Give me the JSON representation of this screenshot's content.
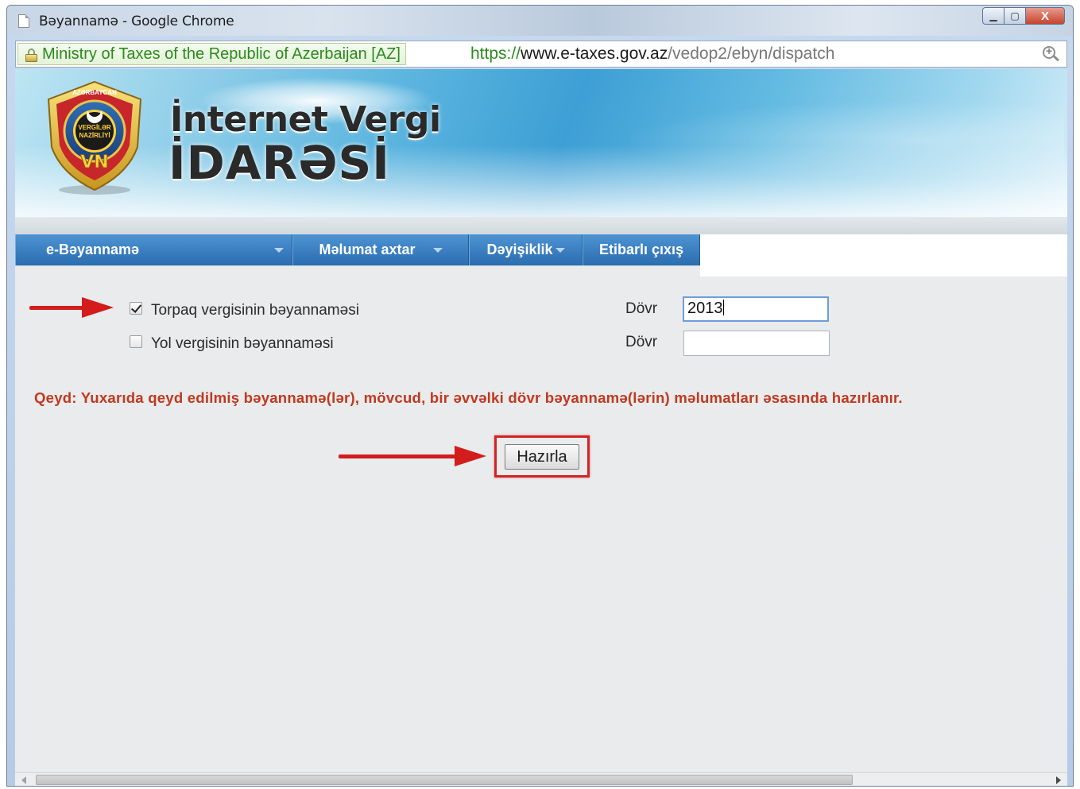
{
  "window": {
    "title": "Bəyannamə - Google Chrome",
    "minimize_symbol": "▁",
    "maximize_symbol": "▢",
    "close_symbol": "X"
  },
  "address_bar": {
    "ev_label": "Ministry of Taxes of the Republic of Azerbaijan [AZ]",
    "url_scheme": "https://",
    "url_host": "www.e-taxes.gov.az",
    "url_path": "/vedop2/ebyn/dispatch"
  },
  "banner": {
    "line1": "İnternet Vergi",
    "line2": "İDARƏSİ",
    "emblem_top_text": "AZƏRBAYCAN",
    "emblem_center_text_1": "VERGİLƏR",
    "emblem_center_text_2": "NAZİRLİYİ",
    "emblem_monogram": "VN"
  },
  "nav": {
    "items": [
      {
        "label": "e-Bəyannamə",
        "has_caret": true
      },
      {
        "label": "Məlumat axtar",
        "has_caret": true
      },
      {
        "label": "Dəyişiklik",
        "has_caret": true
      },
      {
        "label": "Etibarlı çıxış",
        "has_caret": false
      }
    ]
  },
  "form": {
    "rows": [
      {
        "label": "Torpaq vergisinin bəyannaməsi",
        "checked": true,
        "period_label": "Dövr",
        "period_value": "2013"
      },
      {
        "label": "Yol vergisinin bəyannaməsi",
        "checked": false,
        "period_label": "Dövr",
        "period_value": ""
      }
    ],
    "note": "Qeyd: Yuxarıda qeyd edilmiş bəyannamə(lər), mövcud, bir əvvəlki dövr bəyannamə(lərin) məlumatları əsasında hazırlanır.",
    "submit_label": "Hazırla"
  },
  "colors": {
    "nav_blue": "#2a6db0",
    "note_red": "#c0391f",
    "annotation_red": "#d31c1c",
    "ev_green": "#2b8a1d"
  }
}
